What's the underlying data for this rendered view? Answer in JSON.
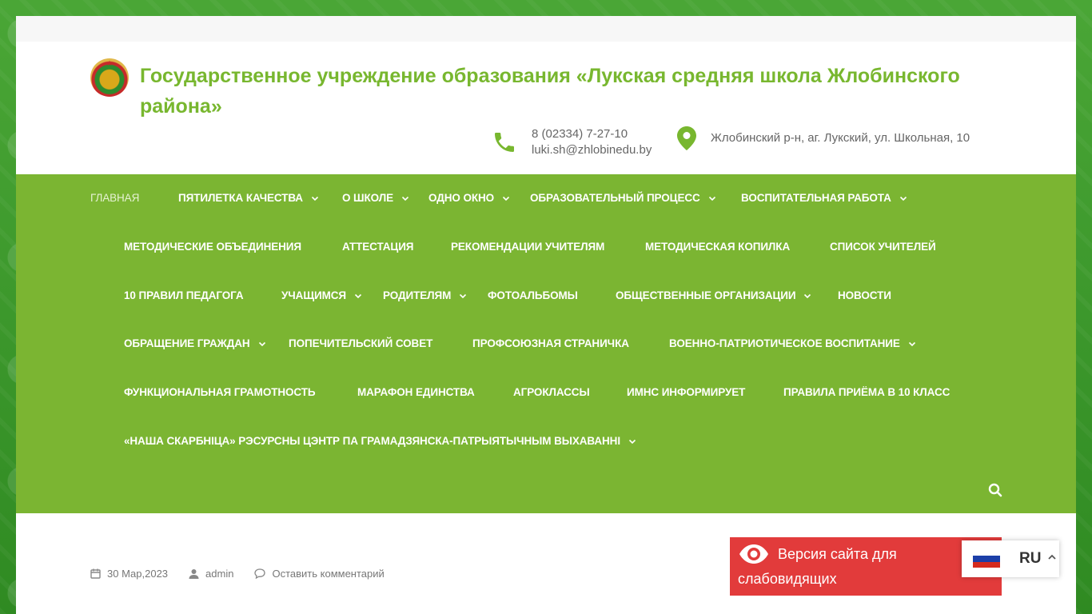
{
  "header": {
    "site_title": "Государственное учреждение образования «Лукская средняя школа Жлобинского района»",
    "phone": "8 (02334) 7-27-10",
    "email": "luki.sh@zhlobinedu.by",
    "address": "Жлобинский р-н, аг. Лукский, ул. Школьная, 10"
  },
  "nav": {
    "items": [
      {
        "label": "Главная",
        "dropdown": false,
        "active": true
      },
      {
        "label": "Пятилетка качества",
        "dropdown": true
      },
      {
        "label": "О школе",
        "dropdown": true
      },
      {
        "label": "Одно окно",
        "dropdown": true
      },
      {
        "label": "Образовательный процесс",
        "dropdown": true
      },
      {
        "label": "Воспитательная работа",
        "dropdown": true
      },
      {
        "label": "Методические объединения",
        "dropdown": false
      },
      {
        "label": "Аттестация",
        "dropdown": false
      },
      {
        "label": "Рекомендации учителям",
        "dropdown": false
      },
      {
        "label": "Методическая копилка",
        "dropdown": false
      },
      {
        "label": "Список учителей",
        "dropdown": false
      },
      {
        "label": "10 правил педагога",
        "dropdown": false
      },
      {
        "label": "Учащимся",
        "dropdown": true
      },
      {
        "label": "Родителям",
        "dropdown": true
      },
      {
        "label": "Фотоальбомы",
        "dropdown": false
      },
      {
        "label": "Общественные организации",
        "dropdown": true
      },
      {
        "label": "Новости",
        "dropdown": false
      },
      {
        "label": "Обращение граждан",
        "dropdown": true
      },
      {
        "label": "Попечительский совет",
        "dropdown": false
      },
      {
        "label": "Профсоюзная страничка",
        "dropdown": false
      },
      {
        "label": "Военно-патриотическое воспитание",
        "dropdown": true
      },
      {
        "label": "Функциональная грамотность",
        "dropdown": false
      },
      {
        "label": "Марафон единства",
        "dropdown": false
      },
      {
        "label": "Агроклассы",
        "dropdown": false
      },
      {
        "label": "ИМНС информирует",
        "dropdown": false
      },
      {
        "label": "Правила приёма в 10 класс",
        "dropdown": false
      },
      {
        "label": "«Наша скарбніца» рэсурсны цэнтр па грамадзянска-патрыятычным выхаванні",
        "dropdown": true
      }
    ]
  },
  "post_meta": {
    "date": "30 Мар,2023",
    "author": "admin",
    "comment_link": "Оставить комментарий"
  },
  "accessibility": {
    "line1": "Версия сайта для",
    "line2": "слабовидящих"
  },
  "language": {
    "code": "RU"
  },
  "colors": {
    "brand_green": "#7bb532",
    "accessibility_red": "#e23b3b"
  }
}
